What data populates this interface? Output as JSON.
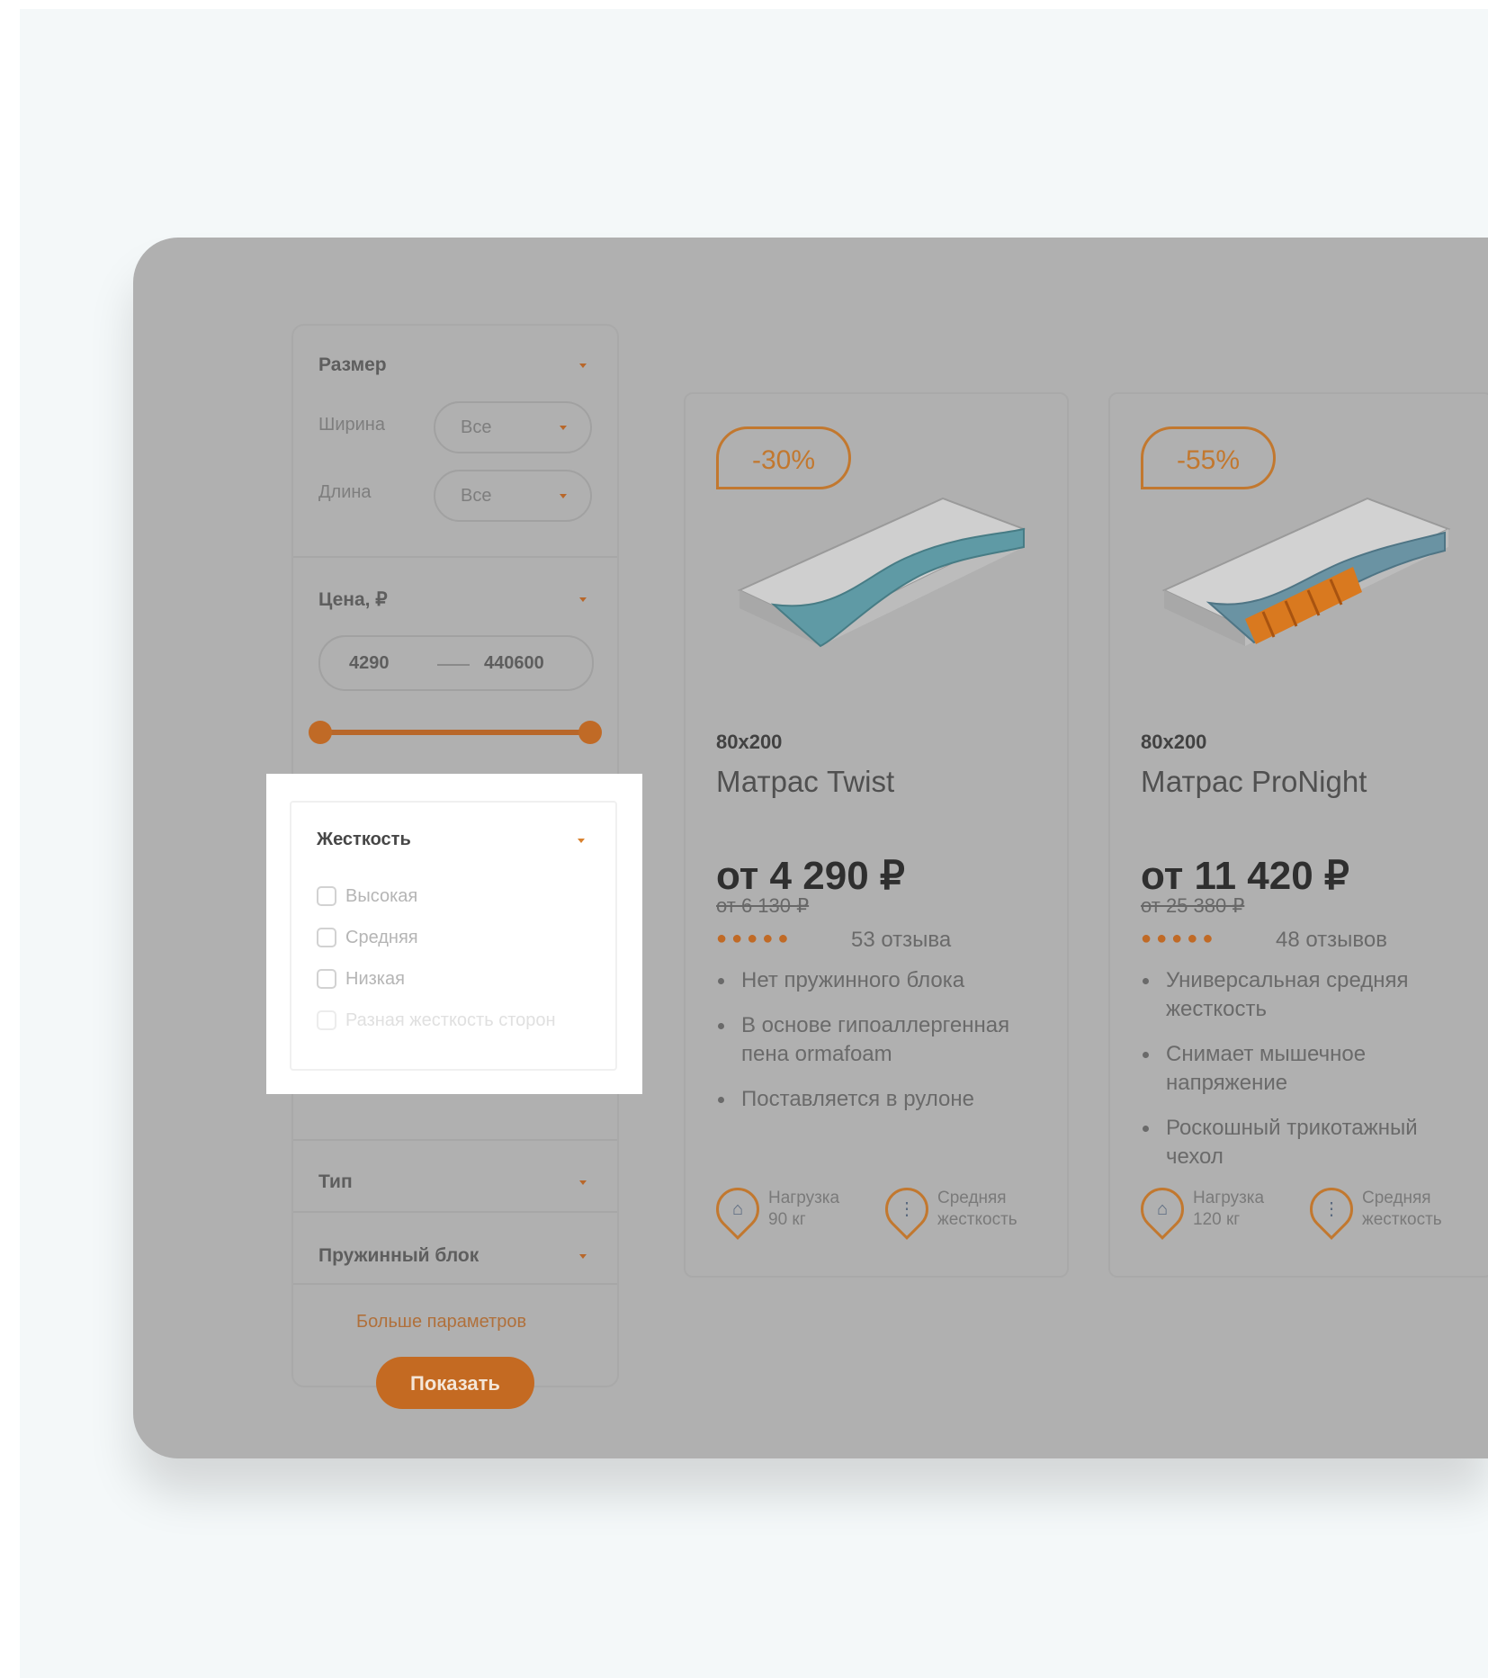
{
  "filters": {
    "size": {
      "title": "Размер",
      "width_label": "Ширина",
      "width_value": "Все",
      "length_label": "Длина",
      "length_value": "Все"
    },
    "price": {
      "title": "Цена, ₽",
      "min": "4290",
      "max": "440600",
      "slider_from": 0,
      "slider_to": 1
    },
    "firmness": {
      "title": "Жесткость",
      "options": [
        "Высокая",
        "Средняя",
        "Низкая",
        "Разная жесткость сторон"
      ]
    },
    "type": {
      "title": "Тип"
    },
    "spring_block": {
      "title": "Пружинный блок"
    },
    "more_link": "Больше параметров",
    "show_button": "Показать"
  },
  "products": [
    {
      "badge": "-30%",
      "size": "80x200",
      "name": "Матрас Twist",
      "price": "от 4 290 ₽",
      "old_price": "от 6 130 ₽",
      "rating": 5,
      "reviews": "53 отзыва",
      "bullets": [
        "Нет пружинного блока",
        "В основе гипоаллергенная пена ormafoam",
        "Поставляется в рулоне"
      ],
      "features": [
        {
          "icon": "weight-icon",
          "line1": "Нагрузка",
          "line2": "90 кг"
        },
        {
          "icon": "firmness-icon",
          "line1": "Средняя",
          "line2": "жесткость"
        }
      ]
    },
    {
      "badge": "-55%",
      "size": "80x200",
      "name": "Матрас ProNight",
      "price": "от 11 420 ₽",
      "old_price": "от 25 380 ₽",
      "rating": 5,
      "reviews": "48 отзывов",
      "bullets": [
        "Универсальная средняя жесткость",
        "Снимает мышечное напряжение",
        "Роскошный трикотажный чехол"
      ],
      "features": [
        {
          "icon": "weight-icon",
          "line1": "Нагрузка",
          "line2": "120 кг"
        },
        {
          "icon": "firmness-icon",
          "line1": "Средняя",
          "line2": "жесткость"
        }
      ]
    }
  ],
  "colors": {
    "accent": "#c46a22",
    "overlay": "#b0b0b0",
    "background": "#f4f8f9"
  }
}
